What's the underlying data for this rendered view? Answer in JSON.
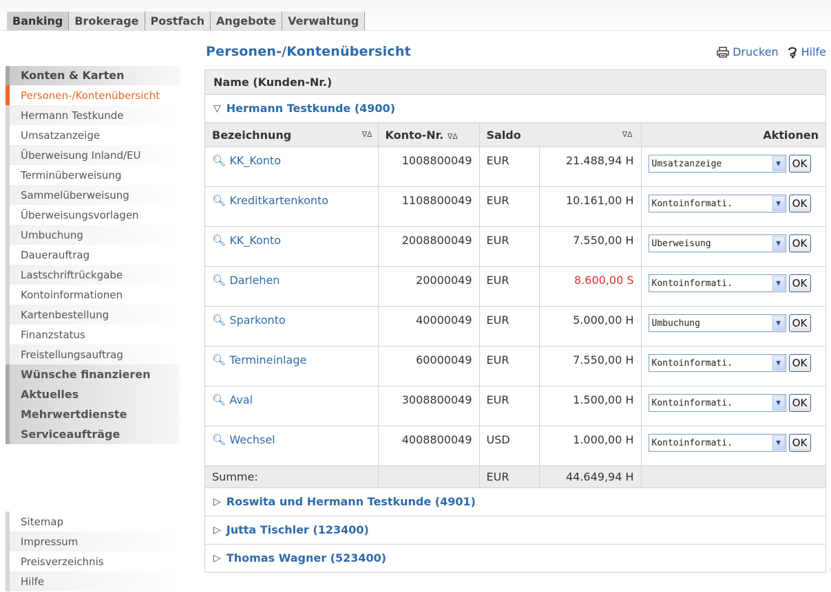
{
  "topnav": {
    "tabs": [
      "Banking",
      "Brokerage",
      "Postfach",
      "Angebote",
      "Verwaltung"
    ]
  },
  "sidebar": {
    "heading": "Konten & Karten",
    "items": [
      "Personen-/Kontenübersicht",
      "Hermann Testkunde",
      "Umsatzanzeige",
      "Überweisung Inland/EU",
      "Terminüberweisung",
      "Sammelüberweisung",
      "Überweisungsvorlagen",
      "Umbuchung",
      "Dauerauftrag",
      "Lastschriftrückgabe",
      "Kontoinformationen",
      "Kartenbestellung",
      "Finanzstatus",
      "Freistellungsauftrag"
    ],
    "sections": [
      "Wünsche finanzieren",
      "Aktuelles",
      "Mehrwertdienste",
      "Serviceaufträge"
    ],
    "footer": [
      "Sitemap",
      "Impressum",
      "Preisverzeichnis",
      "Hilfe"
    ]
  },
  "main": {
    "title": "Personen-/Kontenübersicht",
    "print_label": "Drucken",
    "help_label": "Hilfe",
    "header_name": "Name (Kunden-Nr.)",
    "customer": "Hermann Testkunde (4900)",
    "columns": {
      "bez": "Bezeichnung",
      "konto": "Konto-Nr.",
      "saldo": "Saldo",
      "aktionen": "Aktionen"
    },
    "sort_icon": "∇∆",
    "ok_label": "OK",
    "accounts": [
      {
        "name": "KK_Konto",
        "nr": "1008800049",
        "cur": "EUR",
        "amount": "21.488,94 H",
        "action": "Umsatzanzeige"
      },
      {
        "name": "Kreditkartenkonto",
        "nr": "1108800049",
        "cur": "EUR",
        "amount": "10.161,00 H",
        "action": "Kontoinformati."
      },
      {
        "name": "KK_Konto",
        "nr": "2008800049",
        "cur": "EUR",
        "amount": "7.550,00 H",
        "action": "Überweisung"
      },
      {
        "name": "Darlehen",
        "nr": "20000049",
        "cur": "EUR",
        "amount": "8.600,00 S",
        "action": "Kontoinformati."
      },
      {
        "name": "Sparkonto",
        "nr": "40000049",
        "cur": "EUR",
        "amount": "5.000,00 H",
        "action": "Umbuchung"
      },
      {
        "name": "Termineinlage",
        "nr": "60000049",
        "cur": "EUR",
        "amount": "7.550,00 H",
        "action": "Kontoinformati."
      },
      {
        "name": "Aval",
        "nr": "3008800049",
        "cur": "EUR",
        "amount": "1.500,00 H",
        "action": "Kontoinformati."
      },
      {
        "name": "Wechsel",
        "nr": "4008800049",
        "cur": "USD",
        "amount": "1.000,00 H",
        "action": "Kontoinformati."
      }
    ],
    "sum": {
      "label": "Summe:",
      "cur": "EUR",
      "amount": "44.649,94 H"
    },
    "other_customers": [
      "Roswita und Hermann Testkunde (4901)",
      "Jutta Tischler (123400)",
      "Thomas Wagner (523400)"
    ]
  },
  "colors": {
    "link": "#2d6aa8",
    "active_nav": "#f26622",
    "negative": "#e02b2b"
  }
}
